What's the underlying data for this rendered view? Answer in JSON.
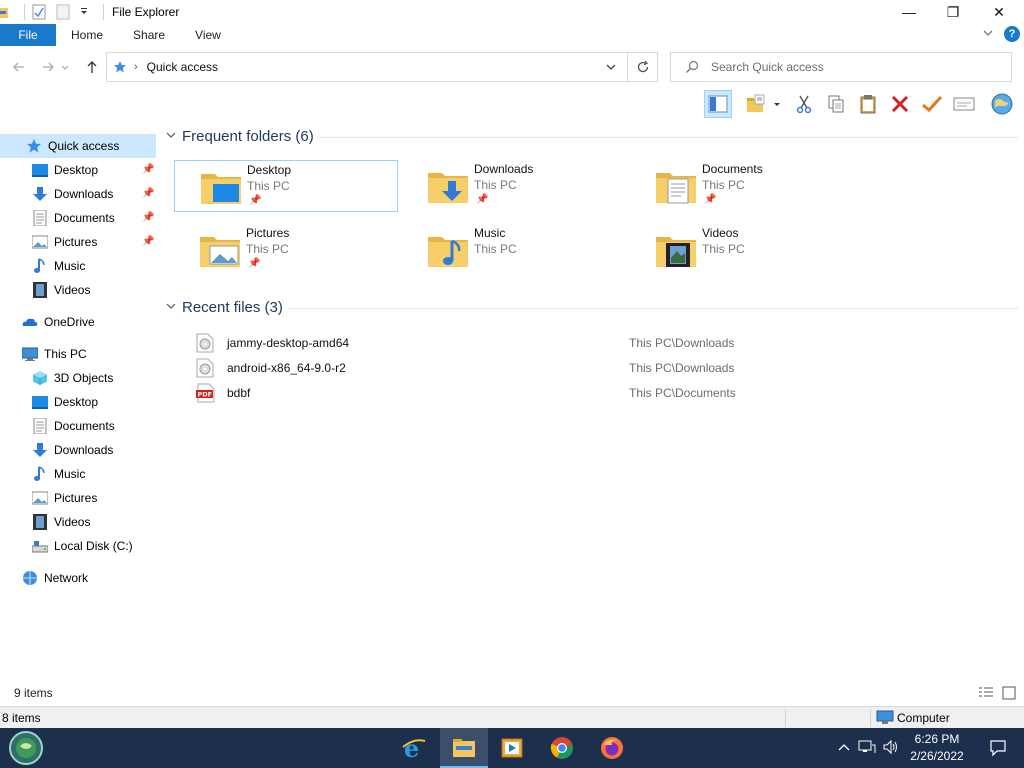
{
  "window": {
    "title": "File Explorer",
    "minimize_glyph": "—",
    "maximize_glyph": "❐",
    "close_glyph": "✕"
  },
  "ribbon": {
    "tabs": [
      "File",
      "Home",
      "Share",
      "View"
    ],
    "help_glyph": "?"
  },
  "address": {
    "path": "Quick access",
    "search_placeholder": "Search Quick access"
  },
  "nav": {
    "quick_access": "Quick access",
    "pinned": [
      "Desktop",
      "Downloads",
      "Documents",
      "Pictures"
    ],
    "unpinned": [
      "Music",
      "Videos"
    ],
    "onedrive": "OneDrive",
    "this_pc": "This PC",
    "this_pc_items": [
      "3D Objects",
      "Desktop",
      "Documents",
      "Downloads",
      "Music",
      "Pictures",
      "Videos",
      "Local Disk (C:)"
    ],
    "network": "Network"
  },
  "frequent": {
    "header": "Frequent folders (6)",
    "folders": [
      {
        "name": "Desktop",
        "location": "This PC",
        "pinned": true
      },
      {
        "name": "Downloads",
        "location": "This PC",
        "pinned": true
      },
      {
        "name": "Documents",
        "location": "This PC",
        "pinned": true
      },
      {
        "name": "Pictures",
        "location": "This PC",
        "pinned": true
      },
      {
        "name": "Music",
        "location": "This PC",
        "pinned": false
      },
      {
        "name": "Videos",
        "location": "This PC",
        "pinned": false
      }
    ]
  },
  "recent": {
    "header": "Recent files (3)",
    "files": [
      {
        "name": "jammy-desktop-amd64",
        "path": "This PC\\Downloads",
        "icon": "disc-image-icon"
      },
      {
        "name": "android-x86_64-9.0-r2",
        "path": "This PC\\Downloads",
        "icon": "disc-image-icon"
      },
      {
        "name": "bdbf",
        "path": "This PC\\Documents",
        "icon": "pdf-icon"
      }
    ]
  },
  "status": {
    "items": "9 items",
    "items_bottom": "8 items",
    "computer": "Computer"
  },
  "taskbar": {
    "time": "6:26 PM",
    "date": "2/26/2022"
  },
  "colors": {
    "accent": "#1979ca",
    "selection": "#cce8ff",
    "taskbar": "#1c2f4d",
    "folder": "#f3c75b"
  }
}
